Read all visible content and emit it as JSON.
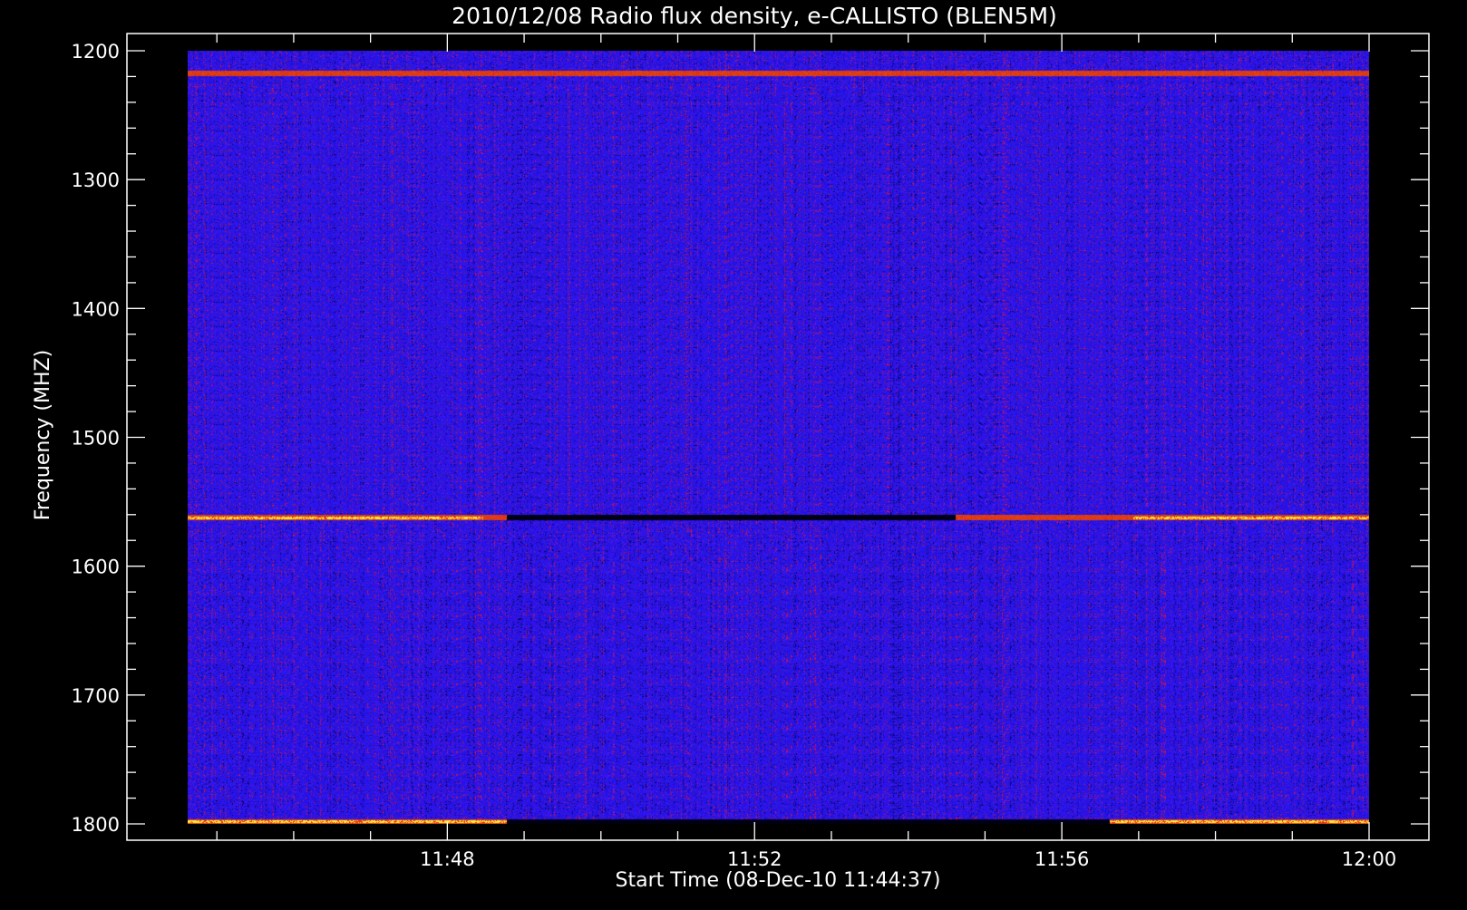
{
  "chart_data": {
    "type": "heatmap",
    "title": "2010/12/08  Radio flux density, e-CALLISTO (BLEN5M)",
    "xlabel": "Start Time (08-Dec-10 11:44:37)",
    "ylabel": "Frequency (MHZ)",
    "xlim_minutes": [
      44.62,
      60
    ],
    "ylim": [
      1800,
      1200
    ],
    "x_tick_labels": [
      "11:48",
      "11:52",
      "11:56",
      "12:00"
    ],
    "x_tick_values": [
      48,
      52,
      56,
      60
    ],
    "y_tick_labels": [
      "1200",
      "1300",
      "1400",
      "1500",
      "1600",
      "1700",
      "1800"
    ],
    "y_tick_values": [
      1200,
      1300,
      1400,
      1500,
      1600,
      1700,
      1800
    ],
    "bands": [
      {
        "freq": 1217,
        "intensity": "high"
      },
      {
        "freq": 1562,
        "intensity": "high"
      },
      {
        "freq": 1798,
        "intensity": "high"
      }
    ],
    "colors": {
      "background": "#000000",
      "base": "#1a1aff",
      "mid": "#c01010",
      "high": "#ffff40"
    }
  }
}
